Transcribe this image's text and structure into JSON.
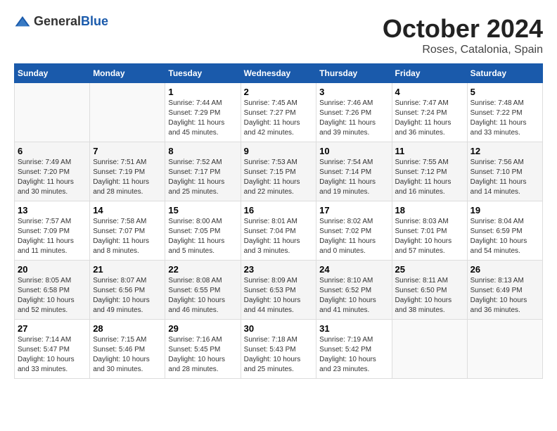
{
  "header": {
    "logo_general": "General",
    "logo_blue": "Blue",
    "month_title": "October 2024",
    "location": "Roses, Catalonia, Spain"
  },
  "days_of_week": [
    "Sunday",
    "Monday",
    "Tuesday",
    "Wednesday",
    "Thursday",
    "Friday",
    "Saturday"
  ],
  "weeks": [
    [
      {
        "day": "",
        "sunrise": "",
        "sunset": "",
        "daylight": ""
      },
      {
        "day": "",
        "sunrise": "",
        "sunset": "",
        "daylight": ""
      },
      {
        "day": "1",
        "sunrise": "Sunrise: 7:44 AM",
        "sunset": "Sunset: 7:29 PM",
        "daylight": "Daylight: 11 hours and 45 minutes."
      },
      {
        "day": "2",
        "sunrise": "Sunrise: 7:45 AM",
        "sunset": "Sunset: 7:27 PM",
        "daylight": "Daylight: 11 hours and 42 minutes."
      },
      {
        "day": "3",
        "sunrise": "Sunrise: 7:46 AM",
        "sunset": "Sunset: 7:26 PM",
        "daylight": "Daylight: 11 hours and 39 minutes."
      },
      {
        "day": "4",
        "sunrise": "Sunrise: 7:47 AM",
        "sunset": "Sunset: 7:24 PM",
        "daylight": "Daylight: 11 hours and 36 minutes."
      },
      {
        "day": "5",
        "sunrise": "Sunrise: 7:48 AM",
        "sunset": "Sunset: 7:22 PM",
        "daylight": "Daylight: 11 hours and 33 minutes."
      }
    ],
    [
      {
        "day": "6",
        "sunrise": "Sunrise: 7:49 AM",
        "sunset": "Sunset: 7:20 PM",
        "daylight": "Daylight: 11 hours and 30 minutes."
      },
      {
        "day": "7",
        "sunrise": "Sunrise: 7:51 AM",
        "sunset": "Sunset: 7:19 PM",
        "daylight": "Daylight: 11 hours and 28 minutes."
      },
      {
        "day": "8",
        "sunrise": "Sunrise: 7:52 AM",
        "sunset": "Sunset: 7:17 PM",
        "daylight": "Daylight: 11 hours and 25 minutes."
      },
      {
        "day": "9",
        "sunrise": "Sunrise: 7:53 AM",
        "sunset": "Sunset: 7:15 PM",
        "daylight": "Daylight: 11 hours and 22 minutes."
      },
      {
        "day": "10",
        "sunrise": "Sunrise: 7:54 AM",
        "sunset": "Sunset: 7:14 PM",
        "daylight": "Daylight: 11 hours and 19 minutes."
      },
      {
        "day": "11",
        "sunrise": "Sunrise: 7:55 AM",
        "sunset": "Sunset: 7:12 PM",
        "daylight": "Daylight: 11 hours and 16 minutes."
      },
      {
        "day": "12",
        "sunrise": "Sunrise: 7:56 AM",
        "sunset": "Sunset: 7:10 PM",
        "daylight": "Daylight: 11 hours and 14 minutes."
      }
    ],
    [
      {
        "day": "13",
        "sunrise": "Sunrise: 7:57 AM",
        "sunset": "Sunset: 7:09 PM",
        "daylight": "Daylight: 11 hours and 11 minutes."
      },
      {
        "day": "14",
        "sunrise": "Sunrise: 7:58 AM",
        "sunset": "Sunset: 7:07 PM",
        "daylight": "Daylight: 11 hours and 8 minutes."
      },
      {
        "day": "15",
        "sunrise": "Sunrise: 8:00 AM",
        "sunset": "Sunset: 7:05 PM",
        "daylight": "Daylight: 11 hours and 5 minutes."
      },
      {
        "day": "16",
        "sunrise": "Sunrise: 8:01 AM",
        "sunset": "Sunset: 7:04 PM",
        "daylight": "Daylight: 11 hours and 3 minutes."
      },
      {
        "day": "17",
        "sunrise": "Sunrise: 8:02 AM",
        "sunset": "Sunset: 7:02 PM",
        "daylight": "Daylight: 11 hours and 0 minutes."
      },
      {
        "day": "18",
        "sunrise": "Sunrise: 8:03 AM",
        "sunset": "Sunset: 7:01 PM",
        "daylight": "Daylight: 10 hours and 57 minutes."
      },
      {
        "day": "19",
        "sunrise": "Sunrise: 8:04 AM",
        "sunset": "Sunset: 6:59 PM",
        "daylight": "Daylight: 10 hours and 54 minutes."
      }
    ],
    [
      {
        "day": "20",
        "sunrise": "Sunrise: 8:05 AM",
        "sunset": "Sunset: 6:58 PM",
        "daylight": "Daylight: 10 hours and 52 minutes."
      },
      {
        "day": "21",
        "sunrise": "Sunrise: 8:07 AM",
        "sunset": "Sunset: 6:56 PM",
        "daylight": "Daylight: 10 hours and 49 minutes."
      },
      {
        "day": "22",
        "sunrise": "Sunrise: 8:08 AM",
        "sunset": "Sunset: 6:55 PM",
        "daylight": "Daylight: 10 hours and 46 minutes."
      },
      {
        "day": "23",
        "sunrise": "Sunrise: 8:09 AM",
        "sunset": "Sunset: 6:53 PM",
        "daylight": "Daylight: 10 hours and 44 minutes."
      },
      {
        "day": "24",
        "sunrise": "Sunrise: 8:10 AM",
        "sunset": "Sunset: 6:52 PM",
        "daylight": "Daylight: 10 hours and 41 minutes."
      },
      {
        "day": "25",
        "sunrise": "Sunrise: 8:11 AM",
        "sunset": "Sunset: 6:50 PM",
        "daylight": "Daylight: 10 hours and 38 minutes."
      },
      {
        "day": "26",
        "sunrise": "Sunrise: 8:13 AM",
        "sunset": "Sunset: 6:49 PM",
        "daylight": "Daylight: 10 hours and 36 minutes."
      }
    ],
    [
      {
        "day": "27",
        "sunrise": "Sunrise: 7:14 AM",
        "sunset": "Sunset: 5:47 PM",
        "daylight": "Daylight: 10 hours and 33 minutes."
      },
      {
        "day": "28",
        "sunrise": "Sunrise: 7:15 AM",
        "sunset": "Sunset: 5:46 PM",
        "daylight": "Daylight: 10 hours and 30 minutes."
      },
      {
        "day": "29",
        "sunrise": "Sunrise: 7:16 AM",
        "sunset": "Sunset: 5:45 PM",
        "daylight": "Daylight: 10 hours and 28 minutes."
      },
      {
        "day": "30",
        "sunrise": "Sunrise: 7:18 AM",
        "sunset": "Sunset: 5:43 PM",
        "daylight": "Daylight: 10 hours and 25 minutes."
      },
      {
        "day": "31",
        "sunrise": "Sunrise: 7:19 AM",
        "sunset": "Sunset: 5:42 PM",
        "daylight": "Daylight: 10 hours and 23 minutes."
      },
      {
        "day": "",
        "sunrise": "",
        "sunset": "",
        "daylight": ""
      },
      {
        "day": "",
        "sunrise": "",
        "sunset": "",
        "daylight": ""
      }
    ]
  ]
}
